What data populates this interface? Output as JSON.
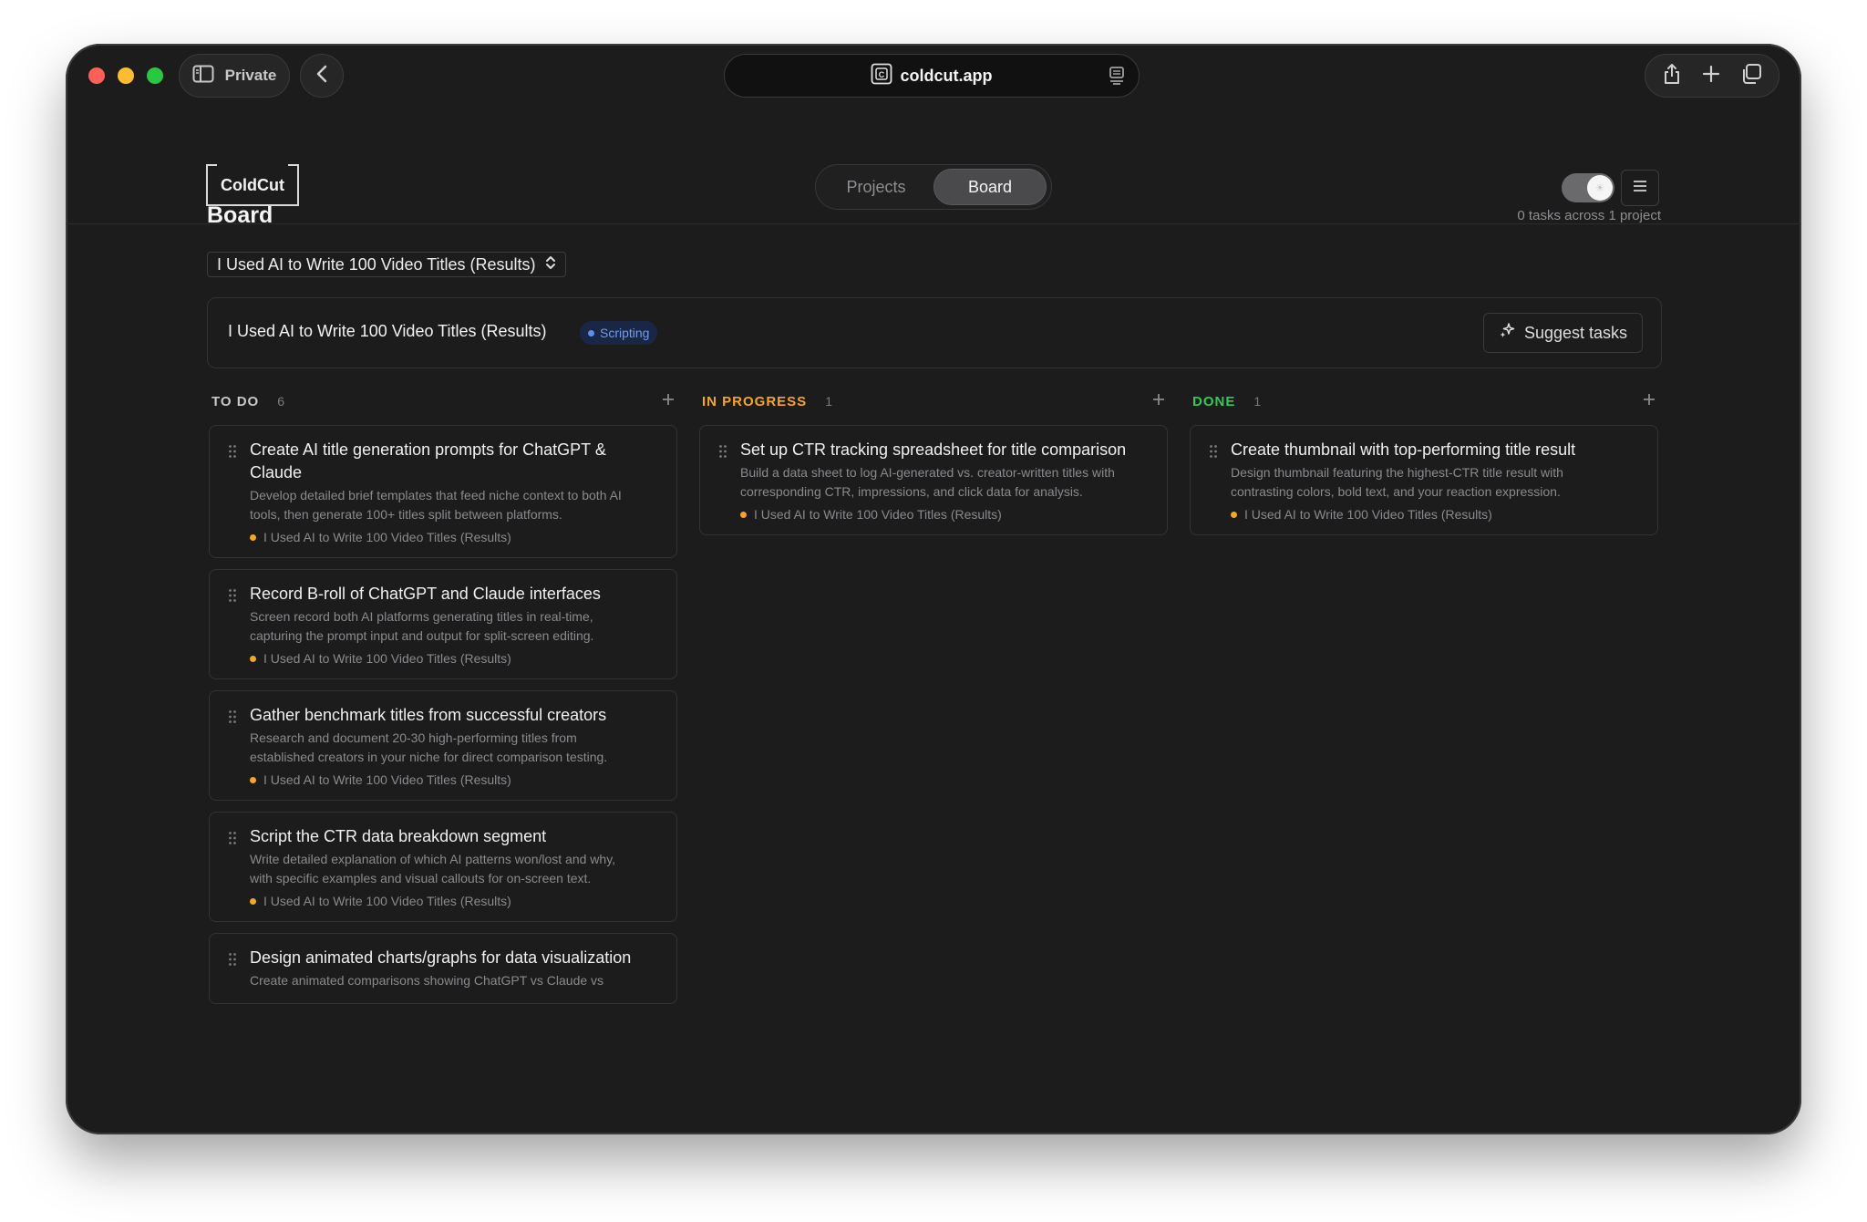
{
  "browser": {
    "private_label": "Private",
    "address": "coldcut.app"
  },
  "app": {
    "logo": "ColdCut",
    "tabs": {
      "projects": "Projects",
      "board": "Board"
    }
  },
  "board": {
    "title": "Board",
    "task_count": "0 tasks across 1 project",
    "project_select": "I Used AI to Write 100 Video Titles (Results)",
    "project_name": "I Used AI to Write 100 Video Titles (Results)",
    "project_stage": "Scripting",
    "suggest_label": "Suggest tasks"
  },
  "colors": {
    "todo": "#c9c9cc",
    "in_progress": "#f5a623",
    "done": "#34c759",
    "stage_badge": "#5b8ef5"
  },
  "columns": [
    {
      "title": "TO DO",
      "count": "6",
      "cards": [
        {
          "title": "Create AI title generation prompts for ChatGPT & Claude",
          "desc": "Develop detailed brief templates that feed niche context to both AI tools, then generate 100+ titles split between platforms.",
          "project": "I Used AI to Write 100 Video Titles (Results)"
        },
        {
          "title": "Record B-roll of ChatGPT and Claude interfaces",
          "desc": "Screen record both AI platforms generating titles in real-time, capturing the prompt input and output for split-screen editing.",
          "project": "I Used AI to Write 100 Video Titles (Results)"
        },
        {
          "title": "Gather benchmark titles from successful creators",
          "desc": "Research and document 20-30 high-performing titles from established creators in your niche for direct comparison testing.",
          "project": "I Used AI to Write 100 Video Titles (Results)"
        },
        {
          "title": "Script the CTR data breakdown segment",
          "desc": "Write detailed explanation of which AI patterns won/lost and why, with specific examples and visual callouts for on-screen text.",
          "project": "I Used AI to Write 100 Video Titles (Results)"
        },
        {
          "title": "Design animated charts/graphs for data visualization",
          "desc": "Create animated comparisons showing ChatGPT vs Claude vs",
          "project": ""
        }
      ]
    },
    {
      "title": "IN PROGRESS",
      "count": "1",
      "cards": [
        {
          "title": "Set up CTR tracking spreadsheet for title comparison",
          "desc": "Build a data sheet to log AI-generated vs. creator-written titles with corresponding CTR, impressions, and click data for analysis.",
          "project": "I Used AI to Write 100 Video Titles (Results)"
        }
      ]
    },
    {
      "title": "DONE",
      "count": "1",
      "cards": [
        {
          "title": "Create thumbnail with top-performing title result",
          "desc": "Design thumbnail featuring the highest-CTR title result with contrasting colors, bold text, and your reaction expression.",
          "project": "I Used AI to Write 100 Video Titles (Results)"
        }
      ]
    }
  ]
}
